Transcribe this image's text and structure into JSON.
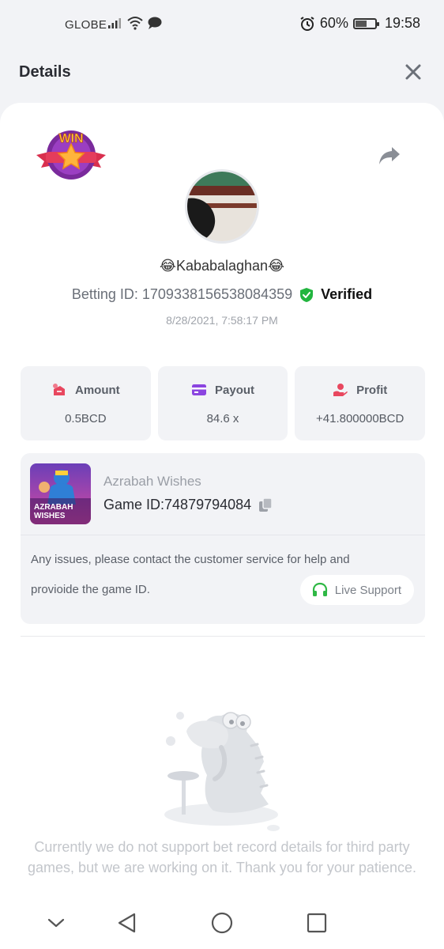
{
  "status_bar": {
    "carrier": "GLOBE",
    "battery_percent": "60%",
    "battery_level": 0.6,
    "time": "19:58"
  },
  "header": {
    "title": "Details",
    "close_icon": "close-icon"
  },
  "bet": {
    "badge_text": "WIN",
    "username": "😂Kababalaghan😂",
    "betting_id_label": "Betting ID: 1709338156538084359",
    "verified_label": "Verified",
    "datetime": "8/28/2021, 7:58:17 PM"
  },
  "stats": [
    {
      "label": "Amount",
      "value": "0.5BCD",
      "icon": "amount-icon",
      "color": "#e8475f"
    },
    {
      "label": "Payout",
      "value": "84.6 x",
      "icon": "payout-card-icon",
      "color": "#8b45e0"
    },
    {
      "label": "Profit",
      "value": "+41.800000BCD",
      "icon": "profit-hand-icon",
      "color": "#e8475f"
    }
  ],
  "game": {
    "thumb_text_line1": "AZRABAH",
    "thumb_text_line2": "WISHES",
    "name": "Azrabah Wishes",
    "game_id_label": "Game ID:",
    "game_id_value": "74879794084",
    "help_line1": "Any issues, please contact the customer service for help and",
    "help_line2": "provioide the game ID.",
    "live_support_label": "Live Support"
  },
  "empty_state": {
    "message": "Currently we do not support bet record details for third party games, but we are working on it. Thank you for your patience."
  },
  "colors": {
    "verified_green": "#22b53f",
    "support_green": "#2fb845",
    "background": "#f2f3f6"
  }
}
